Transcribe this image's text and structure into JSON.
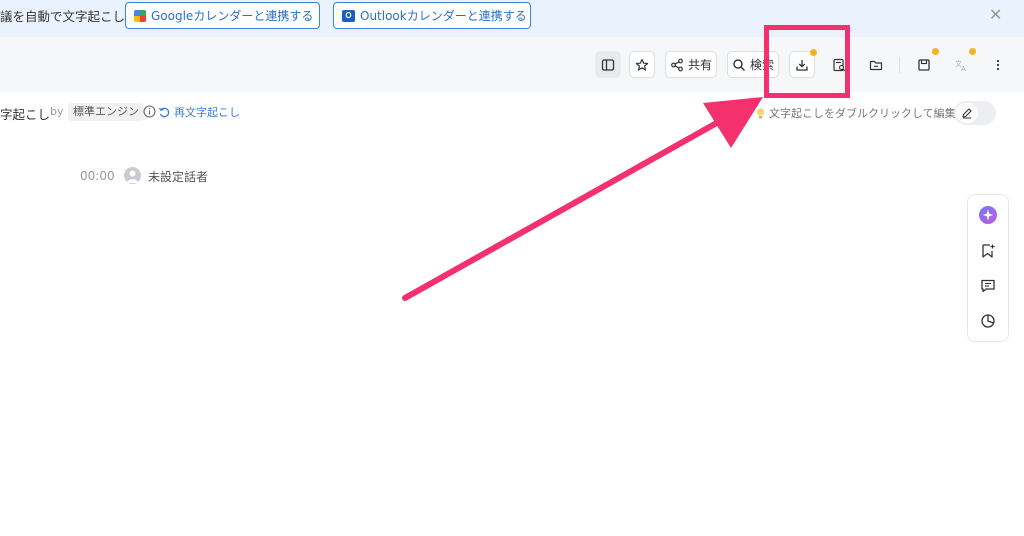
{
  "banner": {
    "text": "議を自動で文字起こし",
    "google_button": "Googleカレンダーと連携する",
    "outlook_button": "Outlookカレンダーと連携する",
    "close_icon": "close-icon"
  },
  "toolbar": {
    "share_label": "共有",
    "search_label": "検索",
    "badge_color": "#f5b323"
  },
  "header": {
    "title": "字起こし",
    "by": "by",
    "engine": "標準エンジン",
    "retranscribe": "再文字起こし",
    "hint": "文字起こしをダブルクリックして編集"
  },
  "transcript": {
    "segments": [
      {
        "timestamp": "00:00",
        "speaker": "未設定話者"
      }
    ]
  },
  "annotation": {
    "color": "#f4306f"
  }
}
